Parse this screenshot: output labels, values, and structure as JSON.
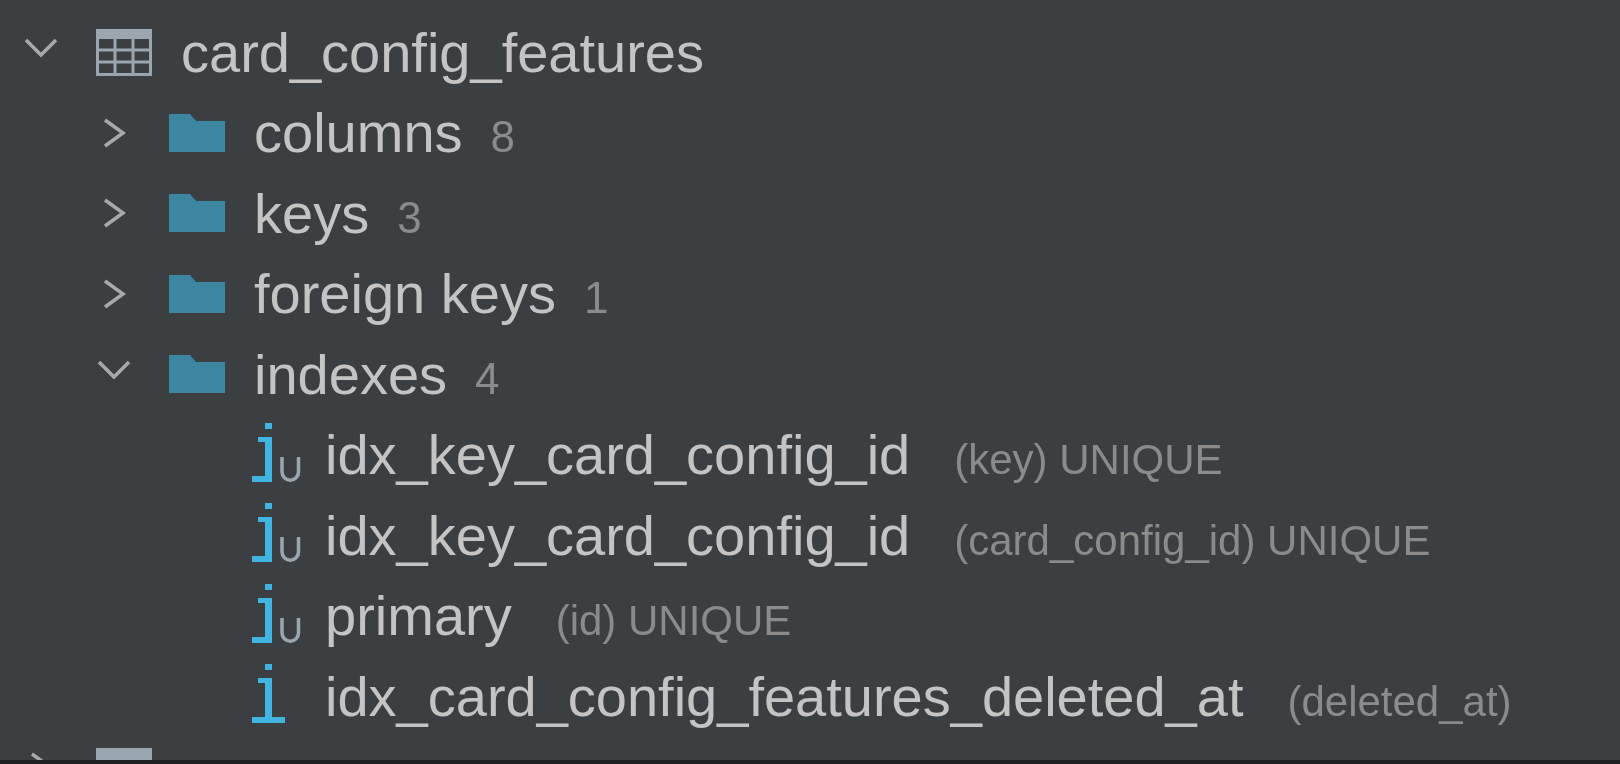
{
  "tree": [
    {
      "kind": "table",
      "name": "card_config_features",
      "expanded": true,
      "children": [
        {
          "kind": "folder",
          "name": "columns",
          "count": "8",
          "expanded": false
        },
        {
          "kind": "folder",
          "name": "keys",
          "count": "3",
          "expanded": false
        },
        {
          "kind": "folder",
          "name": "foreign keys",
          "count": "1",
          "expanded": false
        },
        {
          "kind": "folder",
          "name": "indexes",
          "count": "4",
          "expanded": true,
          "children": [
            {
              "kind": "index",
              "unique": true,
              "name": "idx_key_card_config_id",
              "detail": "(key) UNIQUE"
            },
            {
              "kind": "index",
              "unique": true,
              "name": "idx_key_card_config_id",
              "detail": "(card_config_id) UNIQUE"
            },
            {
              "kind": "index",
              "unique": true,
              "name": "primary",
              "detail": "(id) UNIQUE"
            },
            {
              "kind": "index",
              "unique": false,
              "name": "idx_card_config_features_deleted_at",
              "detail": "(deleted_at)"
            }
          ]
        }
      ]
    },
    {
      "kind": "table",
      "expanded": false
    }
  ]
}
